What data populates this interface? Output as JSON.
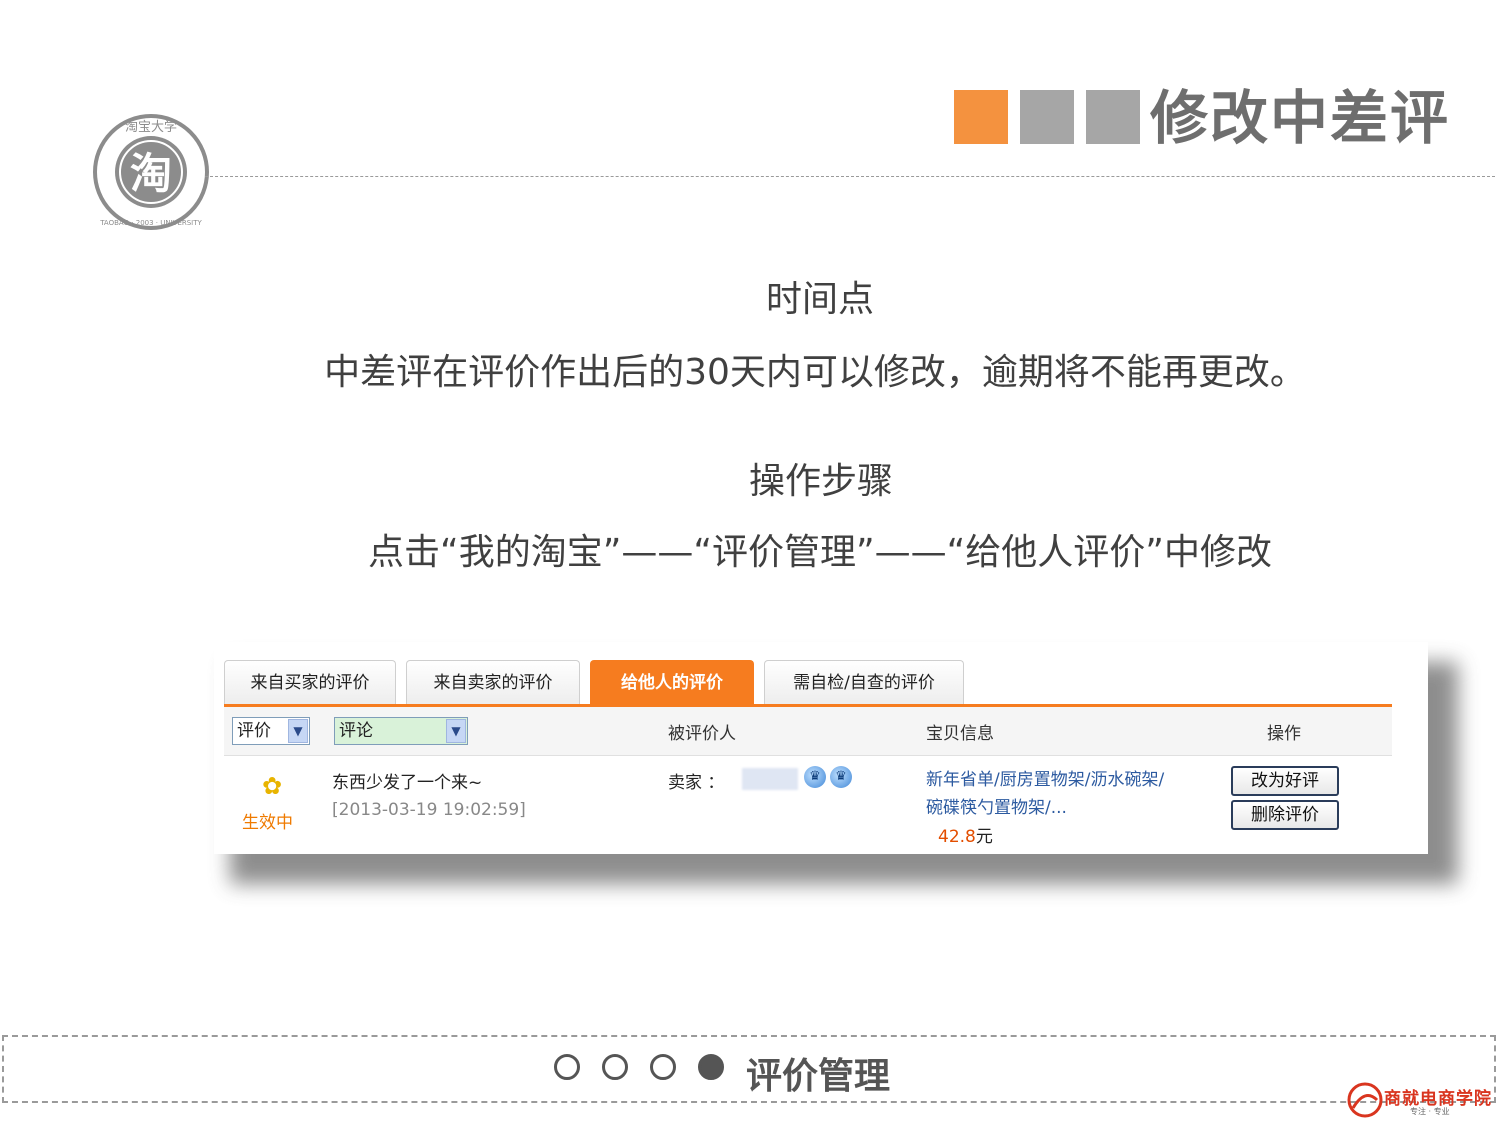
{
  "header": {
    "logo": {
      "center_text": "淘",
      "ring_text": "淘宝大学",
      "bottom_text": "TAOBAO · 2003 · UNIVERSITY"
    },
    "title": "修改中差评"
  },
  "content": {
    "heading1": "时间点",
    "line1": "中差评在评价作出后的30天内可以修改，逾期将不能再更改。",
    "heading2": "操作步骤",
    "line2": "点击“我的淘宝”——“评价管理”——“给他人评价”中修改"
  },
  "panel": {
    "tabs": [
      {
        "label": "来自买家的评价",
        "active": false
      },
      {
        "label": "来自卖家的评价",
        "active": false
      },
      {
        "label": "给他人的评价",
        "active": true
      },
      {
        "label": "需自检/自查的评价",
        "active": false
      }
    ],
    "filters": {
      "rating_select": "评价",
      "comment_select": "评论"
    },
    "columns": {
      "rated_person": "被评价人",
      "item_info": "宝贝信息",
      "actions": "操作"
    },
    "row": {
      "status": "生效中",
      "comment": "东西少发了一个来~",
      "time": "[2013-03-19 19:02:59]",
      "seller_label": "卖家 ：",
      "item_title": "新年省单/厨房置物架/沥水碗架/碗碟筷勺置物架/...",
      "price": "42.8",
      "currency": "元",
      "btn_change": "改为好评",
      "btn_delete": "删除评价"
    }
  },
  "footer": {
    "title": "评价管理",
    "brand": "商就电商学院",
    "brand_sub": "专注 · 专业"
  },
  "colors": {
    "accent": "#f4923f",
    "tab_active": "#f67c1f",
    "gray_square": "#a6a6a6"
  }
}
